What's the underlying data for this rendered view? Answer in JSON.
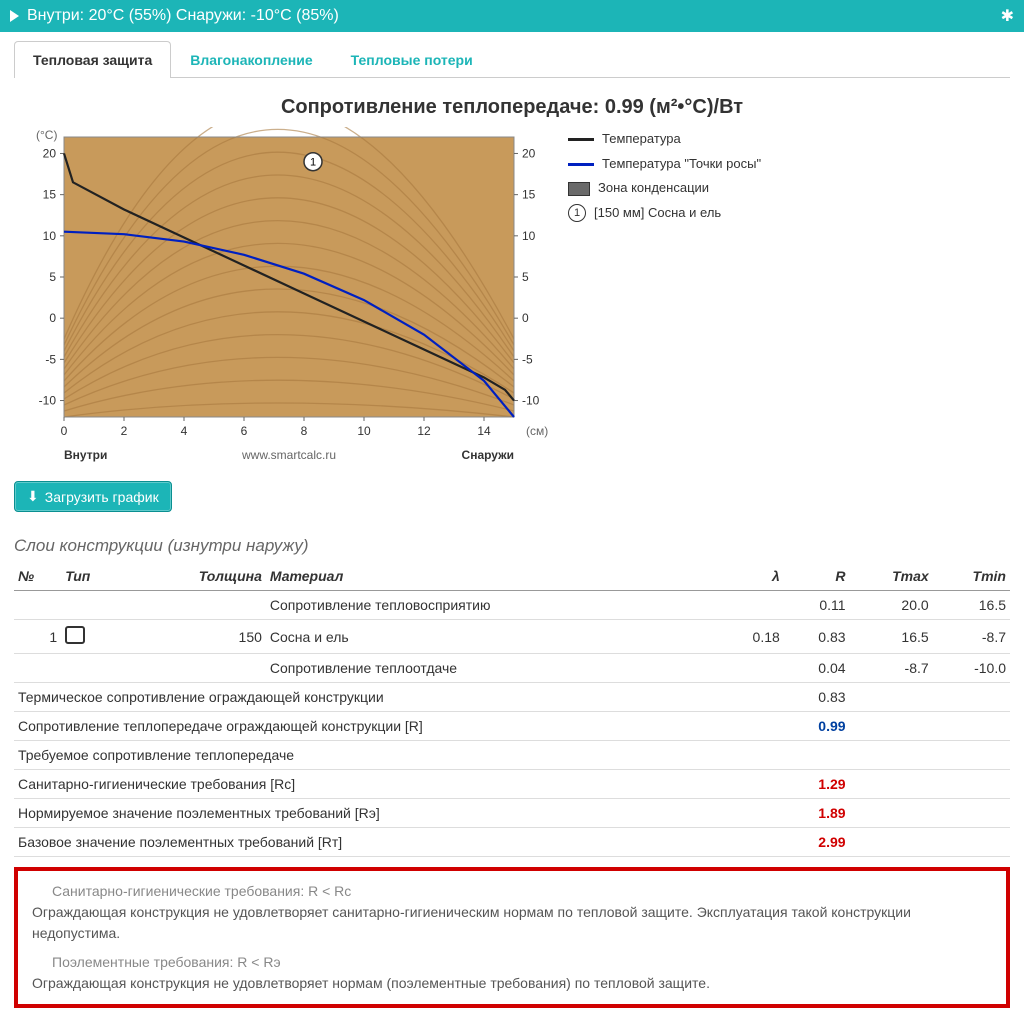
{
  "header": {
    "text": "Внутри: 20°C (55%) Снаружи: -10°C (85%)"
  },
  "tabs": [
    {
      "label": "Тепловая защита",
      "active": true
    },
    {
      "label": "Влагонакопление",
      "active": false
    },
    {
      "label": "Тепловые потери",
      "active": false
    }
  ],
  "title": "Сопротивление теплопередаче: 0.99 (м²•°С)/Вт",
  "chart_data": {
    "type": "line",
    "x_unit": "(см)",
    "y_unit": "(°С)",
    "x_ticks": [
      0,
      2,
      4,
      6,
      8,
      10,
      12,
      14
    ],
    "y_ticks": [
      -10,
      -5,
      0,
      5,
      10,
      15,
      20
    ],
    "x_range": [
      0,
      15
    ],
    "y_range": [
      -12,
      22
    ],
    "left_label": "Внутри",
    "right_label": "Снаружи",
    "watermark": "www.smartcalc.ru",
    "series": [
      {
        "name": "Температура",
        "color": "#222",
        "values": [
          [
            0,
            20
          ],
          [
            0.3,
            16.5
          ],
          [
            2,
            13.2
          ],
          [
            4,
            9.8
          ],
          [
            6,
            6.4
          ],
          [
            8,
            3.0
          ],
          [
            10,
            -0.4
          ],
          [
            12,
            -3.8
          ],
          [
            14,
            -7.2
          ],
          [
            14.7,
            -8.7
          ],
          [
            15,
            -10
          ]
        ]
      },
      {
        "name": "Температура \"Точки росы\"",
        "color": "#0020c0",
        "values": [
          [
            0,
            10.5
          ],
          [
            2,
            10.2
          ],
          [
            4,
            9.3
          ],
          [
            6,
            7.7
          ],
          [
            8,
            5.4
          ],
          [
            10,
            2.2
          ],
          [
            12,
            -2.0
          ],
          [
            14,
            -7.6
          ],
          [
            15,
            -12
          ]
        ]
      }
    ],
    "legend_extra": [
      {
        "type": "box",
        "label": "Зона конденсации"
      },
      {
        "type": "marker",
        "label": "[150 мм] Сосна и ель",
        "num": "1"
      }
    ]
  },
  "download_btn": "Загрузить график",
  "layers_title": "Слои конструкции (изнутри наружу)",
  "table": {
    "headers": {
      "no": "№",
      "type": "Тип",
      "thick": "Толщина",
      "mat": "Материал",
      "lambda": "λ",
      "r": "R",
      "tmax": "Tmax",
      "tmin": "Tmin"
    },
    "rows": [
      {
        "mat": "Сопротивление тепловосприятию",
        "r": "0.11",
        "tmax": "20.0",
        "tmin": "16.5"
      },
      {
        "no": "1",
        "icon": true,
        "thick": "150",
        "mat": "Сосна и ель",
        "lambda": "0.18",
        "r": "0.83",
        "tmax": "16.5",
        "tmin": "-8.7"
      },
      {
        "mat": "Сопротивление теплоотдаче",
        "r": "0.04",
        "tmax": "-8.7",
        "tmin": "-10.0"
      }
    ],
    "summary": [
      {
        "label": "Термическое сопротивление ограждающей конструкции",
        "r": "0.83",
        "cls": ""
      },
      {
        "label": "Сопротивление теплопередаче ограждающей конструкции [R]",
        "r": "0.99",
        "cls": "blue-b"
      },
      {
        "label": "Требуемое сопротивление теплопередаче",
        "r": "",
        "cls": ""
      },
      {
        "label": "Санитарно-гигиенические требования [Rс]",
        "r": "1.29",
        "cls": "red-b"
      },
      {
        "label": "Нормируемое значение поэлементных требований [Rэ]",
        "r": "1.89",
        "cls": "red-b"
      },
      {
        "label": "Базовое значение поэлементных требований [Rт]",
        "r": "2.99",
        "cls": "red-b"
      }
    ]
  },
  "warnings": {
    "h1": "Санитарно-гигиенические требования: R < Rс",
    "p1": "Ограждающая конструкция не удовлетворяет санитарно-гигиеническим нормам по тепловой защите. Эксплуатация такой конструкции недопустима.",
    "h2": "Поэлементные требования: R < Rэ",
    "p2": "Ограждающая конструкция не удовлетворяет нормам (поэлементные требования) по тепловой защите."
  }
}
